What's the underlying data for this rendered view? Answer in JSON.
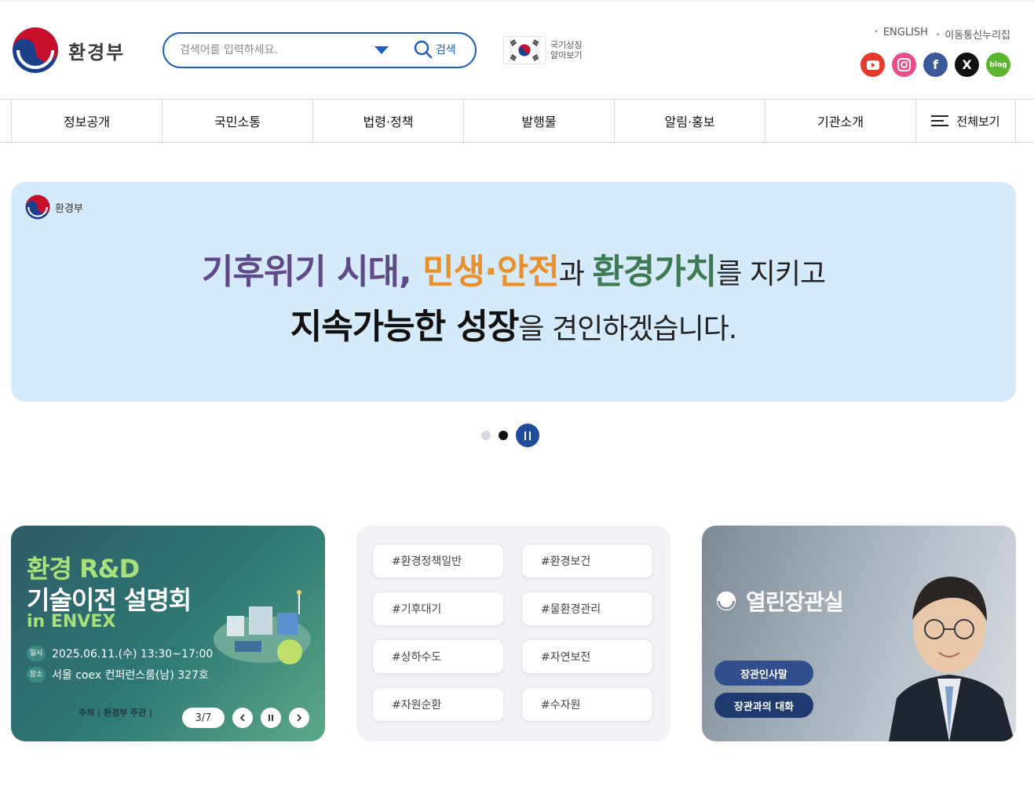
{
  "header": {
    "org_name": "환경부",
    "search": {
      "placeholder": "검색어를 입력하세요.",
      "button_label": "검색"
    },
    "flag_link": {
      "line1": "국기상징",
      "line2": "알아보기"
    },
    "util_links": [
      "ENGLISH",
      "이동통신누리집"
    ],
    "social": [
      {
        "name": "youtube-icon",
        "label": "▶"
      },
      {
        "name": "instagram-icon",
        "label": "◎"
      },
      {
        "name": "facebook-icon",
        "label": "f"
      },
      {
        "name": "x-icon",
        "label": "X"
      },
      {
        "name": "blog-icon",
        "label": "blog"
      }
    ]
  },
  "gnb": {
    "items": [
      "정보공개",
      "국민소통",
      "법령·정책",
      "발행물",
      "알림·홍보",
      "기관소개"
    ],
    "all_menu_label": "전체보기"
  },
  "banner": {
    "org_name": "환경부",
    "line1": {
      "part1": "기후위기 시대, ",
      "part2": "민생·안전",
      "part3": "과 ",
      "part4": "환경가치",
      "part5": "를 지키고"
    },
    "line2": {
      "part1": "지속가능한 성장",
      "part2": "을 견인하겠습니다."
    },
    "pager": {
      "total_dots": 2,
      "active_index": 1
    }
  },
  "cards": {
    "rnd": {
      "title1": "환경 R&D",
      "title2": "기술이전 설명회",
      "title3": "in ENVEX",
      "date_badge": "일시",
      "date_text": "2025.06.11.(수) 13:30~17:00",
      "place_badge": "장소",
      "place_text": "서울 coex 컨퍼런스룸(남) 327호",
      "footer_text": "주최 | 환경부   주관 |",
      "slide_counter": "3/7"
    },
    "tags": [
      "#환경정책일반",
      "#환경보건",
      "#기후대기",
      "#물환경관리",
      "#상하수도",
      "#자연보전",
      "#자원순환",
      "#수자원"
    ],
    "minister": {
      "title": "열린장관실",
      "button1": "장관인사말",
      "button2": "장관과의 대화"
    }
  },
  "colors": {
    "brand_blue": "#1f5fb8",
    "banner_bg": "#d5ebfb",
    "purple": "#5d4a86",
    "orange": "#e8902b",
    "green": "#3f7a55"
  }
}
